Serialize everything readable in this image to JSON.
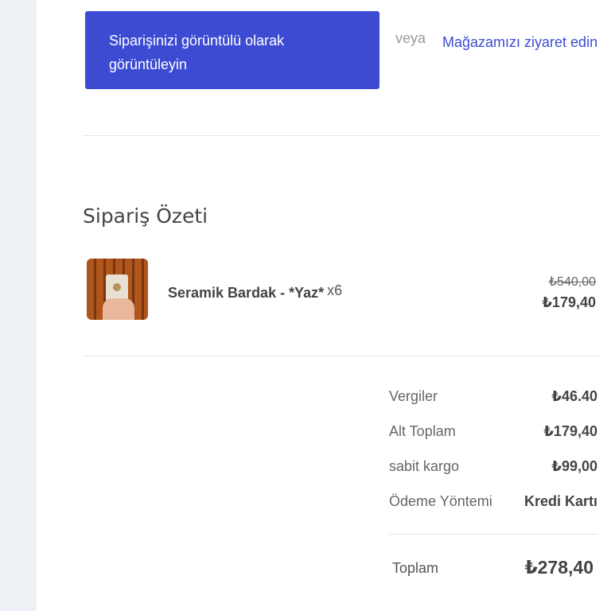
{
  "actions": {
    "view_order_label": "Siparişinizi görüntülü olarak görüntüleyin",
    "or_text": "veya",
    "store_link_label": "Mağazamızı ziyaret edin"
  },
  "summary": {
    "title": "Sipariş Özeti",
    "item": {
      "name": "Seramik Bardak - *Yaz*",
      "quantity": "x6",
      "original_price": "₺540,00",
      "price": "₺179,40"
    }
  },
  "totals": {
    "rows": [
      {
        "label": "Vergiler",
        "value": "₺46.40"
      },
      {
        "label": "Alt Toplam",
        "value": "₺179,40"
      },
      {
        "label": "sabit kargo",
        "value": "₺99,00"
      },
      {
        "label": "Ödeme Yöntemi",
        "value": "Kredi Kartı"
      }
    ],
    "grand_label": "Toplam",
    "grand_value": "₺278,40"
  },
  "colors": {
    "accent": "#3d4bd3",
    "sidebar_bg": "#eef1f6"
  }
}
